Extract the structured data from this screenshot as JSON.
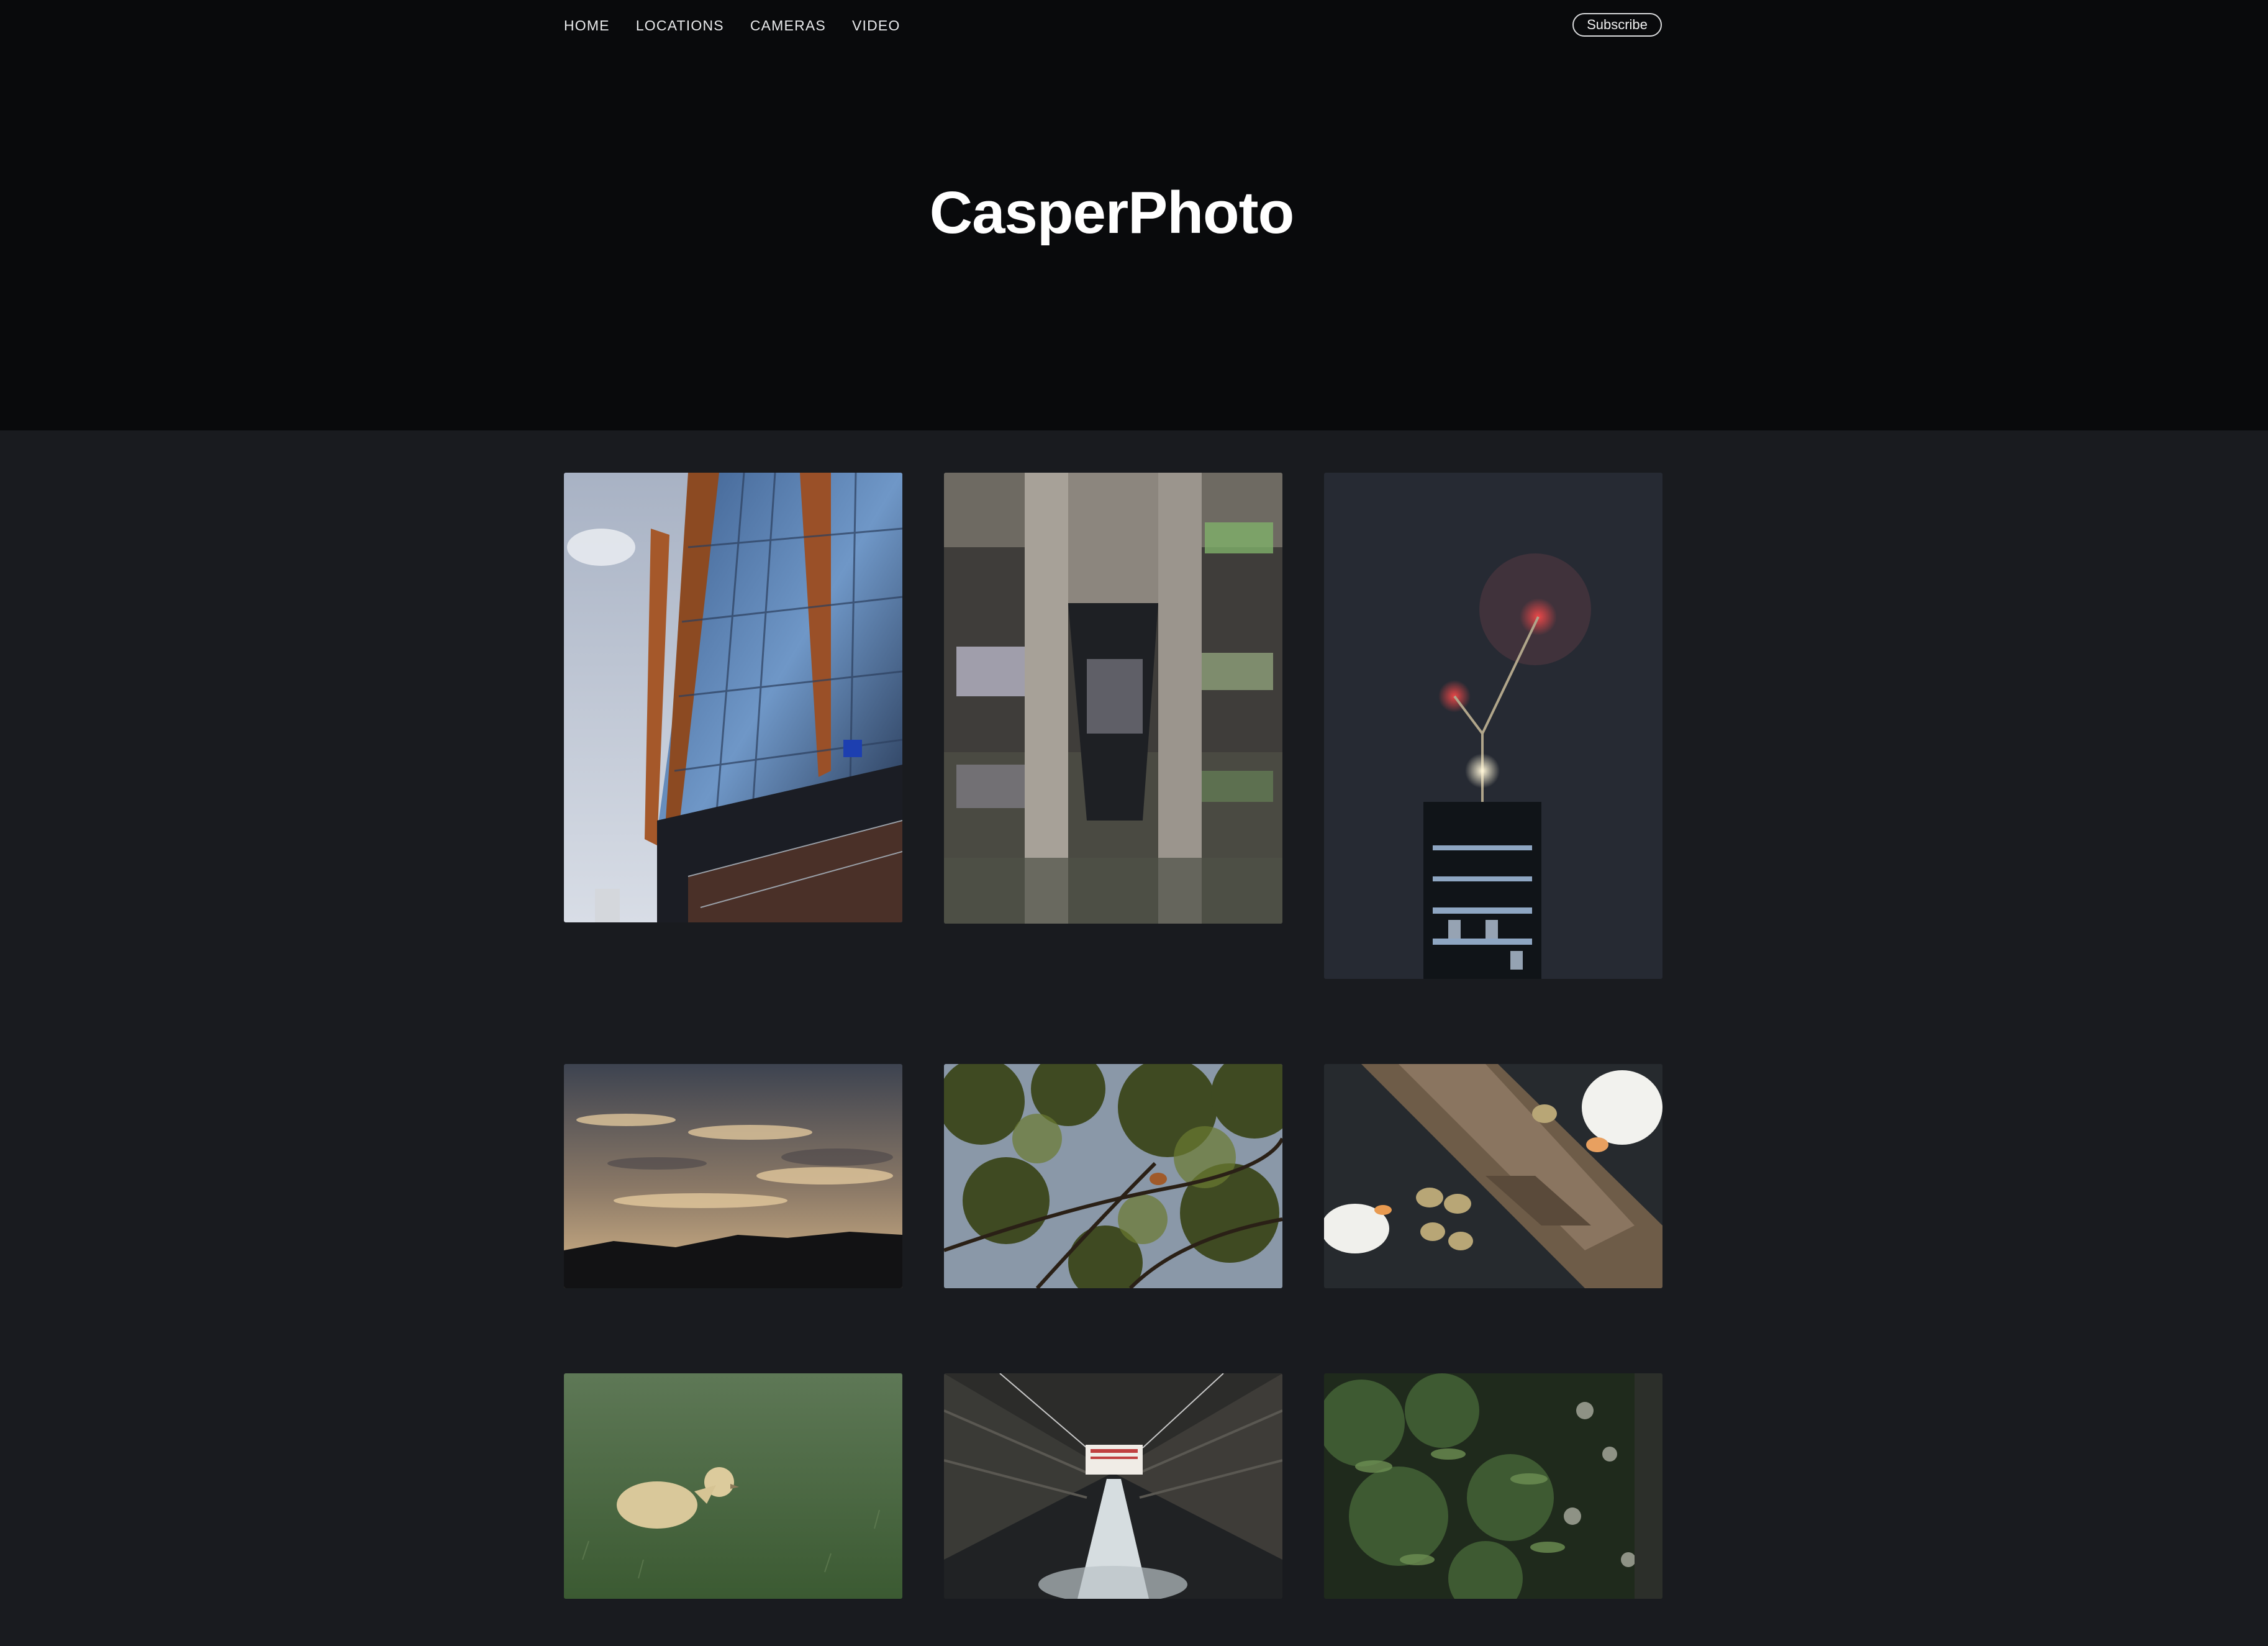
{
  "header": {
    "nav": [
      {
        "label": "HOME"
      },
      {
        "label": "LOCATIONS"
      },
      {
        "label": "CAMERAS"
      },
      {
        "label": "VIDEO"
      }
    ],
    "subscribe_label": "Subscribe",
    "site_title": "CasperPhoto"
  },
  "gallery": {
    "photos": [
      {
        "subject": "glass-building"
      },
      {
        "subject": "graffiti-canal"
      },
      {
        "subject": "crane-night-tower"
      },
      {
        "subject": "sunset-clouds"
      },
      {
        "subject": "tree-branches"
      },
      {
        "subject": "geese-goslings-water"
      },
      {
        "subject": "gosling-grass"
      },
      {
        "subject": "weir-sign"
      },
      {
        "subject": "green-foliage"
      }
    ]
  },
  "colors": {
    "hero_bg": "#090a0c",
    "page_bg": "#191b1f",
    "text": "#ffffff"
  }
}
